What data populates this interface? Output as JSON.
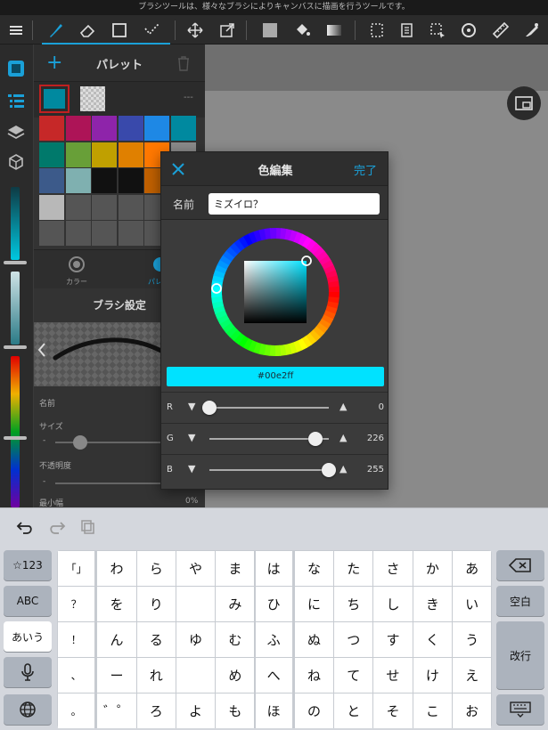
{
  "status_bar": {
    "tip": "ブラシツールは、様々なブラシによりキャンバスに描画を行うツールです。"
  },
  "toolbar": {
    "icons": [
      "menu-icon",
      "brush-icon",
      "eraser-icon",
      "rectangle-icon",
      "line-icon",
      "move-icon",
      "transform-icon",
      "fill-color-icon",
      "bucket-icon",
      "gradient-icon",
      "selection-icon",
      "layer-copy-icon",
      "selection-tool-icon",
      "rotate-icon",
      "ruler-icon",
      "pen-settings-icon"
    ],
    "accent_color": "#1aa0d8"
  },
  "palette_panel": {
    "title": "パレット",
    "add_label": "+",
    "swatch_code": "---",
    "current_color": "#00899f",
    "colors": [
      [
        "#c62828",
        "#ad1457",
        "#8e24aa",
        "#3949ab",
        "#1e88e5",
        "#00899f"
      ],
      [
        "#00796b",
        "#689f38",
        "#c0a000",
        "#e08000",
        "#ff7800",
        "#8a8a8a"
      ],
      [
        "#3c5a8a",
        "#7fb0b0",
        "#111111",
        "#111111",
        "#c06000",
        "#cccccc"
      ],
      [
        "#b8b8b8",
        "#555555",
        "#555555",
        "#555555",
        "#555555",
        "#555555"
      ],
      [
        "#555555",
        "#555555",
        "#555555",
        "#555555",
        "#555555",
        "#555555"
      ]
    ],
    "tab_color_label": "カラー",
    "tab_palette_label": "パレ"
  },
  "brush_settings": {
    "title": "ブラシ設定",
    "name_label": "名前",
    "size_label": "サイズ",
    "opacity_label": "不透明度",
    "min_width_label": "最小幅",
    "min_width_value": "0%",
    "minus_label": "-"
  },
  "color_dialog": {
    "title": "色編集",
    "close_icon": "close-icon",
    "done_label": "完了",
    "name_label": "名前",
    "name_value": "ミズイロ？",
    "hex_value": "#00e2ff",
    "selected_color": "#00e2ff",
    "channels": [
      {
        "label": "R",
        "value": "0",
        "fraction": 0.0
      },
      {
        "label": "G",
        "value": "226",
        "fraction": 0.886
      },
      {
        "label": "B",
        "value": "255",
        "fraction": 1.0
      }
    ]
  },
  "keyboard": {
    "toolbar_icons": [
      "undo-icon",
      "redo-icon",
      "paste-icon"
    ],
    "side_left": [
      "☆123",
      "ABC",
      "あいう",
      "mic",
      "globe"
    ],
    "rows": [
      [
        "「」",
        "わ",
        "ら",
        "や",
        "ま",
        "は",
        "な",
        "た",
        "さ",
        "か",
        "あ"
      ],
      [
        "？",
        "を",
        "り",
        "",
        "み",
        "ひ",
        "に",
        "ち",
        "し",
        "き",
        "い"
      ],
      [
        "！",
        "ん",
        "る",
        "ゆ",
        "む",
        "ふ",
        "ぬ",
        "つ",
        "す",
        "く",
        "う"
      ],
      [
        "、",
        "ー",
        "れ",
        "",
        "め",
        "へ",
        "ね",
        "て",
        "せ",
        "け",
        "え"
      ],
      [
        "。",
        "゛゜",
        "ろ",
        "よ",
        "も",
        "ほ",
        "の",
        "と",
        "そ",
        "こ",
        "お"
      ]
    ],
    "backspace_icon": "backspace-icon",
    "space_label": "空白",
    "return_label": "改行",
    "dismiss_icon": "keyboard-dismiss-icon"
  }
}
